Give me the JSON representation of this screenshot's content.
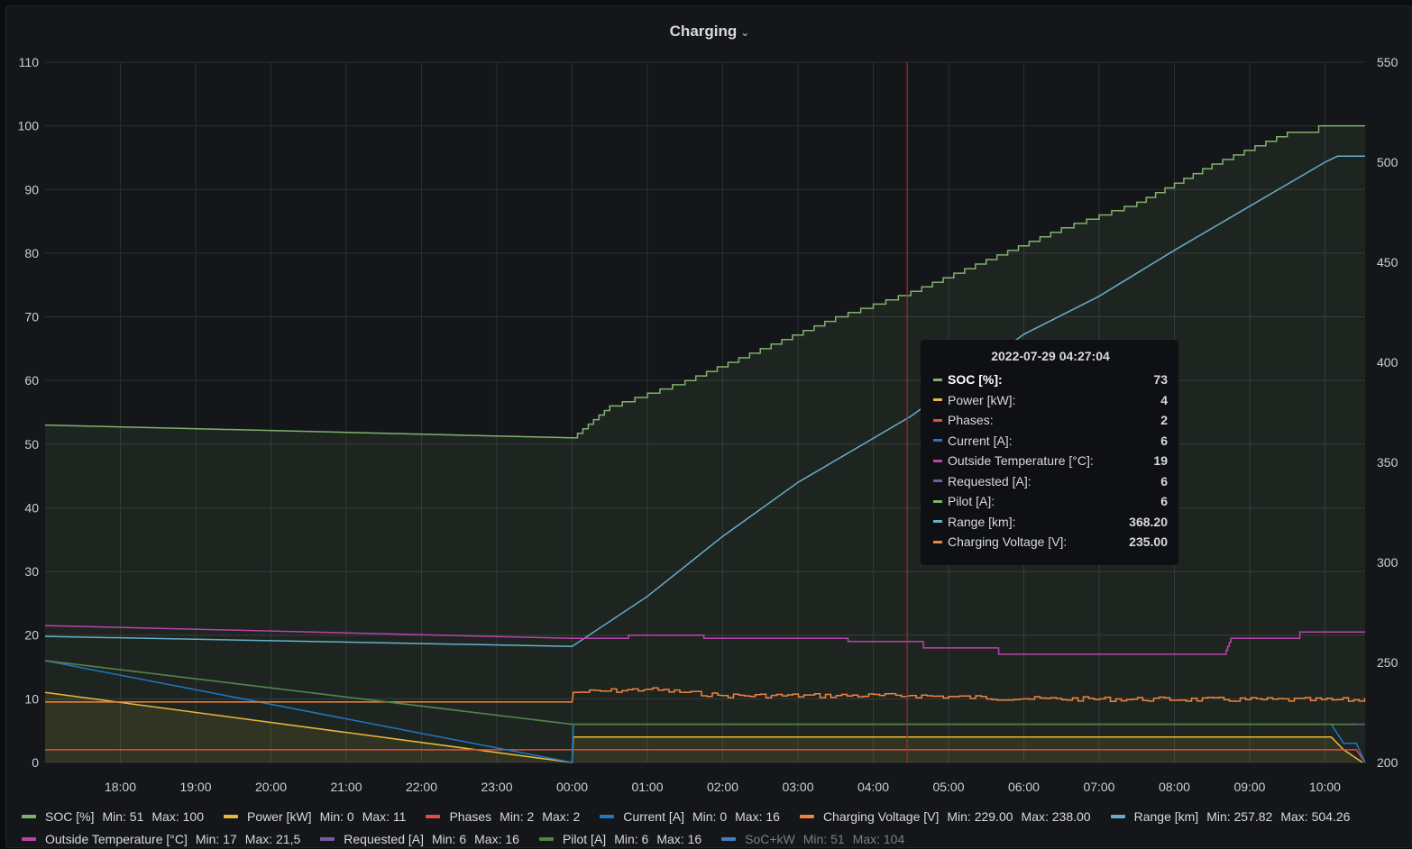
{
  "panel": {
    "title": "Charging"
  },
  "chart_data": {
    "type": "line",
    "x_type": "time",
    "x_range": [
      "2022-07-28 17:00:00",
      "2022-07-29 10:32:00"
    ],
    "x_ticks": [
      "18:00",
      "19:00",
      "20:00",
      "21:00",
      "22:00",
      "23:00",
      "00:00",
      "01:00",
      "02:00",
      "03:00",
      "04:00",
      "05:00",
      "06:00",
      "07:00",
      "08:00",
      "09:00",
      "10:00"
    ],
    "y_left": {
      "range": [
        0,
        110
      ],
      "ticks": [
        0,
        10,
        20,
        30,
        40,
        50,
        60,
        70,
        80,
        90,
        100,
        110
      ]
    },
    "y_right": {
      "range": [
        200,
        550
      ],
      "ticks": [
        200,
        250,
        300,
        350,
        400,
        450,
        500,
        550
      ]
    },
    "grid": true,
    "legend_position": "bottom",
    "crosshair_time": "2022-07-29 04:27:04",
    "series": [
      {
        "name": "SOC [%]",
        "color": "#7eb26d",
        "axis": "left",
        "fill": true,
        "step": true,
        "points": [
          [
            "2022-07-28 17:00",
            53
          ],
          [
            "2022-07-29 00:00",
            51
          ],
          [
            "2022-07-29 00:30",
            56
          ],
          [
            "2022-07-29 01:30",
            60
          ],
          [
            "2022-07-29 02:30",
            65
          ],
          [
            "2022-07-29 03:30",
            70
          ],
          [
            "2022-07-29 04:30",
            74
          ],
          [
            "2022-07-29 05:30",
            79
          ],
          [
            "2022-07-29 06:30",
            84
          ],
          [
            "2022-07-29 07:30",
            88
          ],
          [
            "2022-07-29 08:30",
            94
          ],
          [
            "2022-07-29 09:30",
            99
          ],
          [
            "2022-07-29 09:55",
            100
          ],
          [
            "2022-07-29 10:32",
            100
          ]
        ]
      },
      {
        "name": "Power [kW]",
        "color": "#eab839",
        "axis": "left",
        "fill": true,
        "points": [
          [
            "2022-07-28 17:00",
            11
          ],
          [
            "2022-07-29 00:00",
            0
          ],
          [
            "2022-07-29 00:01",
            4
          ],
          [
            "2022-07-29 10:05",
            4
          ],
          [
            "2022-07-29 10:15",
            2
          ],
          [
            "2022-07-29 10:30",
            0
          ]
        ]
      },
      {
        "name": "Phases",
        "color": "#e24d42",
        "axis": "left",
        "fill": false,
        "points": [
          [
            "2022-07-28 17:00",
            2
          ],
          [
            "2022-07-29 10:25",
            2
          ],
          [
            "2022-07-29 10:32",
            0
          ]
        ]
      },
      {
        "name": "Current [A]",
        "color": "#1f78c1",
        "axis": "left",
        "fill": false,
        "points": [
          [
            "2022-07-28 17:00",
            16
          ],
          [
            "2022-07-29 00:00",
            0
          ],
          [
            "2022-07-29 00:01",
            6
          ],
          [
            "2022-07-29 10:05",
            6
          ],
          [
            "2022-07-29 10:15",
            3
          ],
          [
            "2022-07-29 10:25",
            3
          ],
          [
            "2022-07-29 10:32",
            0
          ]
        ]
      },
      {
        "name": "Charging Voltage [V]",
        "color": "#ef843c",
        "axis": "left",
        "fill": false,
        "noisy": true,
        "points": [
          [
            "2022-07-28 17:00",
            9.5
          ],
          [
            "2022-07-29 00:00",
            9.5
          ],
          [
            "2022-07-29 00:01",
            11
          ],
          [
            "2022-07-29 01:00",
            11.5
          ],
          [
            "2022-07-29 02:00",
            10.5
          ],
          [
            "2022-07-29 04:30",
            10.5
          ],
          [
            "2022-07-29 06:00",
            10
          ],
          [
            "2022-07-29 10:32",
            9.8
          ]
        ]
      },
      {
        "name": "Range [km]",
        "color": "#64b0c8",
        "axis": "right",
        "fill": false,
        "points": [
          [
            "2022-07-28 17:00",
            263
          ],
          [
            "2022-07-29 00:00",
            258
          ],
          [
            "2022-07-29 01:00",
            283
          ],
          [
            "2022-07-29 02:00",
            313
          ],
          [
            "2022-07-29 03:00",
            340
          ],
          [
            "2022-07-29 04:30",
            373
          ],
          [
            "2022-07-29 06:00",
            414
          ],
          [
            "2022-07-29 07:00",
            433
          ],
          [
            "2022-07-29 08:00",
            456
          ],
          [
            "2022-07-29 09:00",
            478
          ],
          [
            "2022-07-29 10:00",
            500
          ],
          [
            "2022-07-29 10:10",
            503
          ],
          [
            "2022-07-29 10:32",
            503
          ]
        ]
      },
      {
        "name": "Outside Temperature [°C]",
        "color": "#ba43a9",
        "axis": "left",
        "fill": false,
        "step": true,
        "points": [
          [
            "2022-07-28 17:00",
            21.5
          ],
          [
            "2022-07-29 00:00",
            19.5
          ],
          [
            "2022-07-29 00:45",
            20
          ],
          [
            "2022-07-29 01:45",
            19.5
          ],
          [
            "2022-07-29 03:40",
            19
          ],
          [
            "2022-07-29 04:40",
            18
          ],
          [
            "2022-07-29 05:40",
            17
          ],
          [
            "2022-07-29 08:40",
            17
          ],
          [
            "2022-07-29 08:45",
            19.5
          ],
          [
            "2022-07-29 09:40",
            20.5
          ],
          [
            "2022-07-29 10:32",
            20.5
          ]
        ]
      },
      {
        "name": "Requested [A]",
        "color": "#705da0",
        "axis": "left",
        "fill": false,
        "points": [
          [
            "2022-07-28 17:00",
            16
          ],
          [
            "2022-07-29 00:00",
            6
          ],
          [
            "2022-07-29 10:32",
            6
          ]
        ]
      },
      {
        "name": "Pilot [A]",
        "color": "#508642",
        "axis": "left",
        "fill": false,
        "points": [
          [
            "2022-07-28 17:00",
            16
          ],
          [
            "2022-07-29 00:00",
            6
          ],
          [
            "2022-07-29 10:25",
            6
          ]
        ]
      },
      {
        "name": "SoC+kW",
        "color": "#447ebc",
        "axis": "left",
        "fill": false,
        "hidden": true,
        "points": []
      }
    ]
  },
  "tooltip": {
    "time": "2022-07-29 04:27:04",
    "rows": [
      {
        "name": "SOC [%]:",
        "value": "73",
        "color": "#7eb26d",
        "highlight": true
      },
      {
        "name": "Power [kW]:",
        "value": "4",
        "color": "#eab839"
      },
      {
        "name": "Phases:",
        "value": "2",
        "color": "#e24d42"
      },
      {
        "name": "Current [A]:",
        "value": "6",
        "color": "#1f78c1"
      },
      {
        "name": "Outside Temperature [°C]:",
        "value": "19",
        "color": "#ba43a9"
      },
      {
        "name": "Requested [A]:",
        "value": "6",
        "color": "#705da0"
      },
      {
        "name": "Pilot [A]:",
        "value": "6",
        "color": "#7eb26d"
      },
      {
        "name": "Range [km]:",
        "value": "368.20",
        "color": "#64b0c8"
      },
      {
        "name": "Charging Voltage [V]:",
        "value": "235.00",
        "color": "#ef843c"
      }
    ]
  },
  "legend": [
    {
      "name": "SOC [%]",
      "min": "Min: 51",
      "max": "Max: 100",
      "color": "#7eb26d"
    },
    {
      "name": "Power [kW]",
      "min": "Min: 0",
      "max": "Max: 11",
      "color": "#eab839"
    },
    {
      "name": "Phases",
      "min": "Min: 2",
      "max": "Max: 2",
      "color": "#e24d42"
    },
    {
      "name": "Current [A]",
      "min": "Min: 0",
      "max": "Max: 16",
      "color": "#1f78c1"
    },
    {
      "name": "Charging Voltage [V]",
      "min": "Min: 229.00",
      "max": "Max: 238.00",
      "color": "#ef843c"
    },
    {
      "name": "Range [km]",
      "min": "Min: 257.82",
      "max": "Max: 504.26",
      "color": "#64b0c8"
    },
    {
      "name": "Outside Temperature [°C]",
      "min": "Min: 17",
      "max": "Max: 21,5",
      "color": "#ba43a9"
    },
    {
      "name": "Requested [A]",
      "min": "Min: 6",
      "max": "Max: 16",
      "color": "#705da0"
    },
    {
      "name": "Pilot [A]",
      "min": "Min: 6",
      "max": "Max: 16",
      "color": "#508642"
    },
    {
      "name": "SoC+kW",
      "min": "Min: 51",
      "max": "Max: 104",
      "color": "#447ebc",
      "hidden": true
    }
  ]
}
